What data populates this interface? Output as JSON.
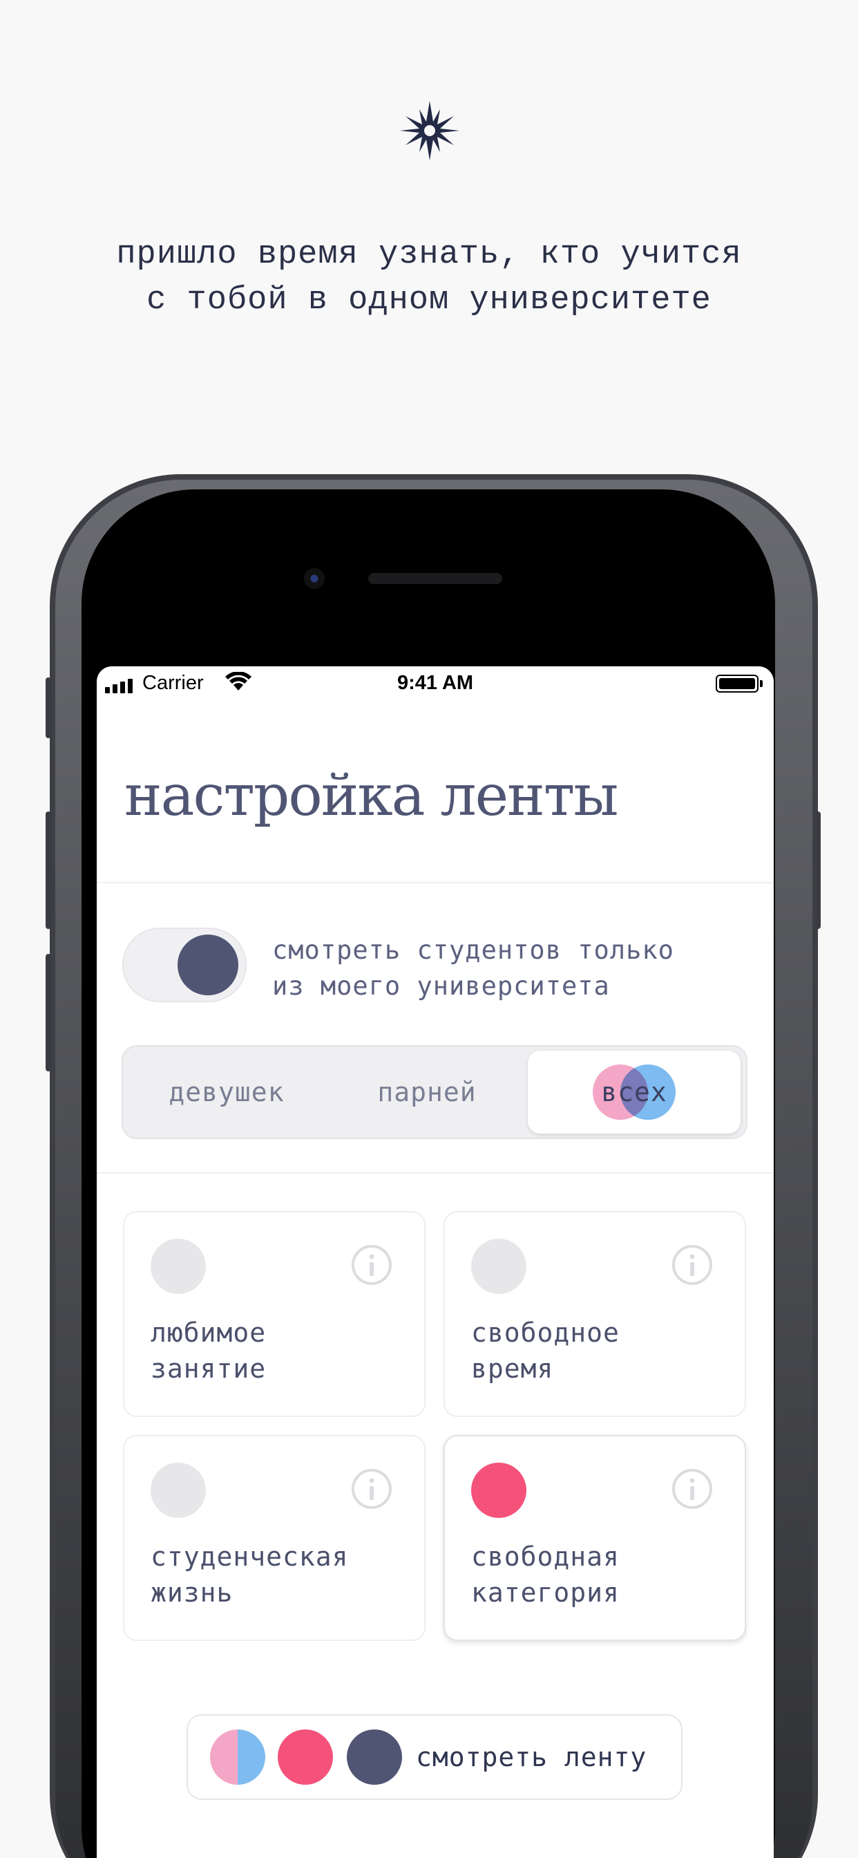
{
  "tagline": {
    "line1": "пришло время узнать, кто учится",
    "line2": "с тобой в одном университете"
  },
  "status_bar": {
    "carrier": "Carrier",
    "time": "9:41 AM"
  },
  "screen": {
    "title": "настройка ленты",
    "toggle": {
      "on": true,
      "line1": "смотреть студентов только",
      "line2": "из моего университета"
    },
    "segment": {
      "options": [
        "девушек",
        "парней",
        "всех"
      ],
      "selected": "всех"
    },
    "categories": [
      {
        "line1": "любимое",
        "line2": "занятие",
        "selected": false
      },
      {
        "line1": "свободное",
        "line2": "время",
        "selected": false
      },
      {
        "line1": "студенческая",
        "line2": "жизнь",
        "selected": false
      },
      {
        "line1": "свободная",
        "line2": "категория",
        "selected": true
      }
    ],
    "feed_button": {
      "label": "смотреть ленту"
    }
  },
  "colors": {
    "accent_pink": "#f4527a",
    "navy": "#4f5573",
    "soft_pink": "#f4a6c6",
    "soft_blue": "#7dbbf0",
    "inactive_dot": "#e7e7e9"
  },
  "icons": [
    "star-logo-icon",
    "cellular-signal-icon",
    "wifi-icon",
    "battery-icon",
    "info-icon"
  ]
}
